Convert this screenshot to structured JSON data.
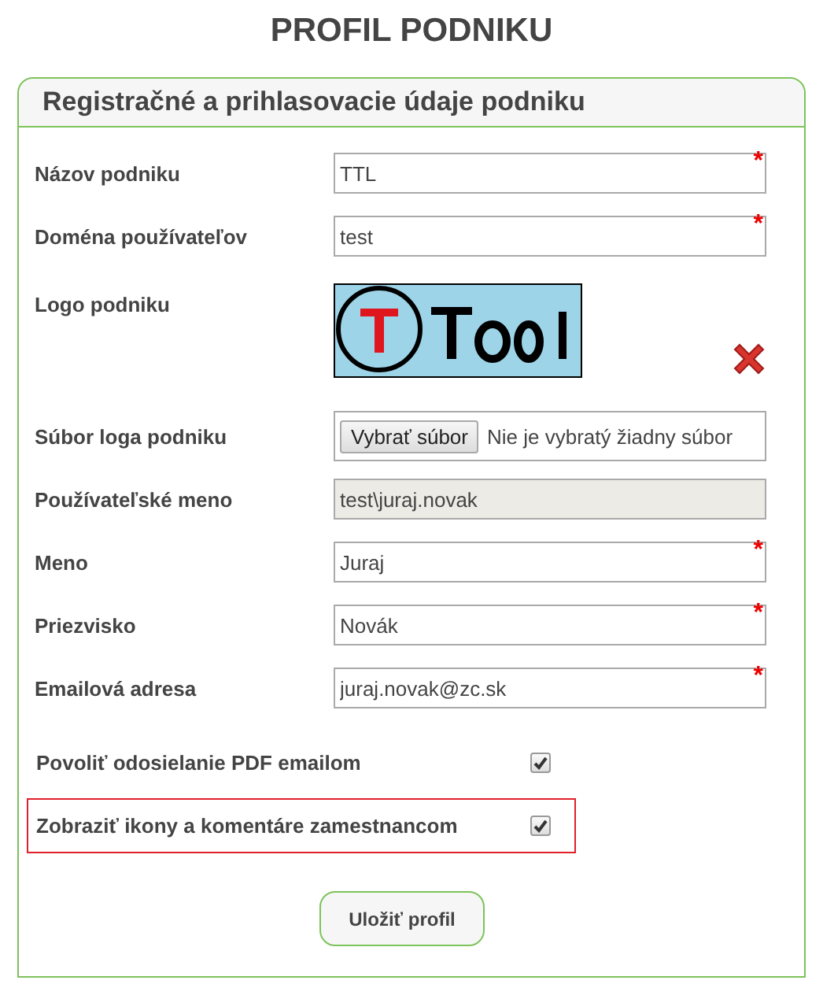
{
  "title": "PROFIL PODNIKU",
  "panel": {
    "heading": "Registračné a prihlasovacie údaje podniku",
    "rows": [
      {
        "kind": "text",
        "label": "Názov podniku",
        "value": "TTL",
        "required_mark": "*",
        "disabled": false
      },
      {
        "kind": "text",
        "label": "Doména používateľov",
        "value": "test",
        "required_mark": "*",
        "disabled": false
      },
      {
        "kind": "logo",
        "label": "Logo podniku"
      },
      {
        "kind": "file",
        "label": "Súbor loga podniku",
        "button": "Vybrať súbor",
        "status": "Nie je vybratý žiadny súbor"
      },
      {
        "kind": "text",
        "label": "Používateľské meno",
        "value": "test\\juraj.novak",
        "disabled": true
      },
      {
        "kind": "text",
        "label": "Meno",
        "value": "Juraj",
        "required_mark": "*",
        "disabled": false
      },
      {
        "kind": "text",
        "label": "Priezvisko",
        "value": "Novák",
        "required_mark": "*",
        "disabled": false
      },
      {
        "kind": "text",
        "label": "Emailová adresa",
        "value": "juraj.novak@zc.sk",
        "required_mark": "*",
        "disabled": false
      },
      {
        "kind": "checkbox",
        "label": "Povoliť odosielanie PDF emailom",
        "checked": true,
        "highlighted": false
      },
      {
        "kind": "checkbox",
        "label": "Zobraziť ikony a komentáre zamestnancom",
        "checked": true,
        "highlighted": true
      }
    ],
    "save_button": "Uložiť profil"
  }
}
